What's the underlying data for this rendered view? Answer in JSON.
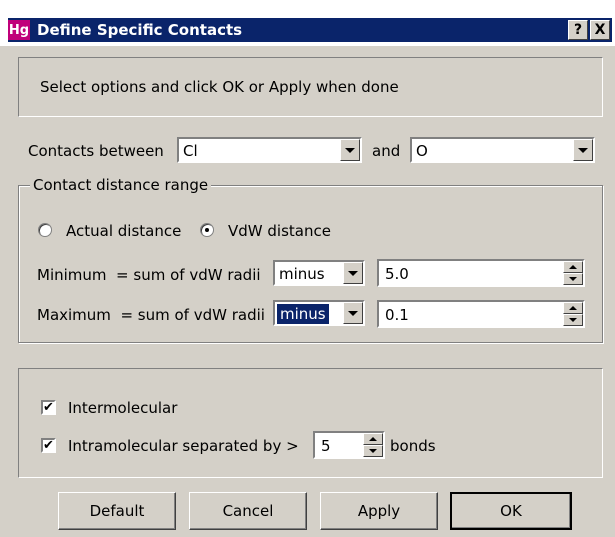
{
  "window": {
    "app_icon_text": "Hg",
    "title": "Define Specific Contacts",
    "help_glyph": "?",
    "close_glyph": "X",
    "title_bar_color": "#0a246a"
  },
  "info": {
    "message": "Select options and click OK or Apply when done"
  },
  "contacts": {
    "label_between": "Contacts between",
    "atom1": "Cl",
    "label_and": "and",
    "atom2": "O"
  },
  "distance": {
    "group_label": "Contact distance range",
    "radio_actual": "Actual distance",
    "radio_vdw": "VdW distance",
    "selected_mode": "VdW distance",
    "min_label": "Minimum  = sum of vdW radii",
    "min_op": "minus",
    "min_value": "5.0",
    "max_label": "Maximum  = sum of vdW radii",
    "max_op": "minus",
    "max_value": "0.1"
  },
  "options": {
    "intermolecular_label": "Intermolecular",
    "intermolecular_checked": true,
    "intramolecular_label": "Intramolecular separated by >",
    "intramolecular_checked": true,
    "bonds_value": "5",
    "bonds_label": "bonds"
  },
  "buttons": {
    "default": "Default",
    "cancel": "Cancel",
    "apply": "Apply",
    "ok": "OK"
  }
}
